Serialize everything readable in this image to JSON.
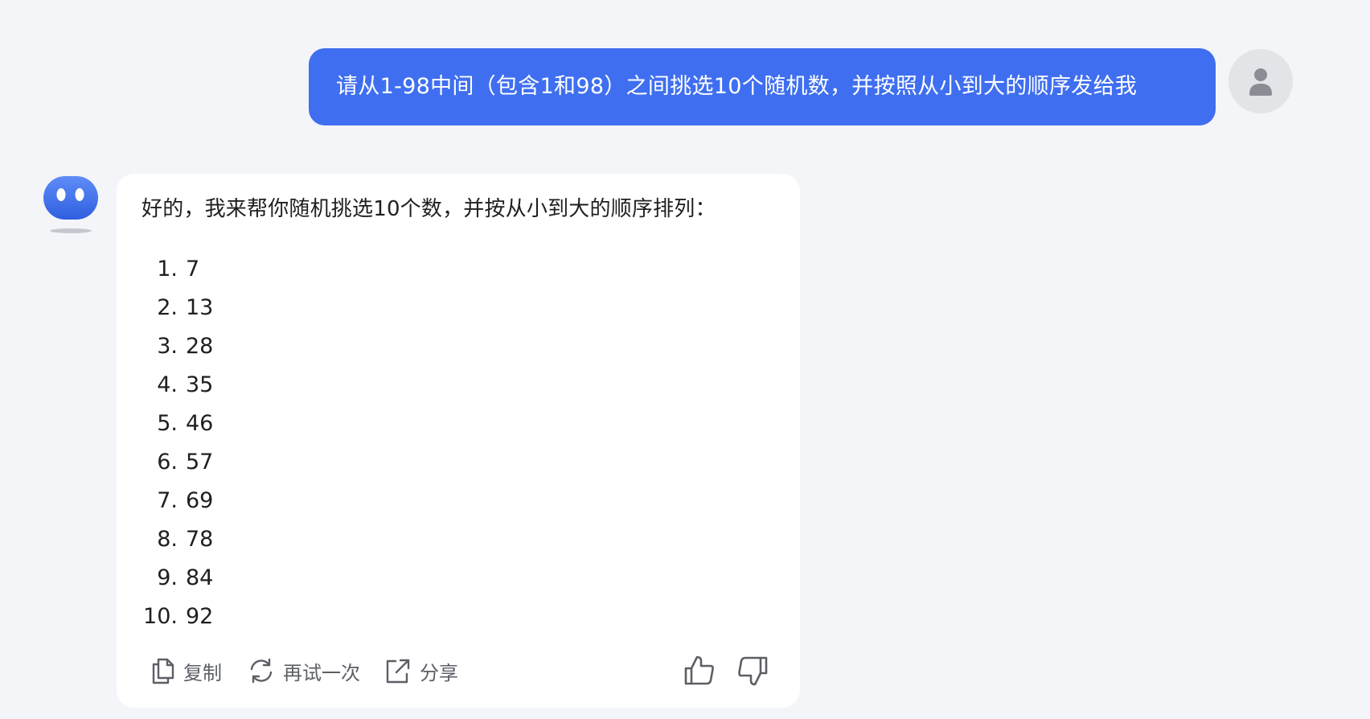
{
  "user_message": {
    "text": "请从1-98中间（包含1和98）之间挑选10个随机数，并按照从小到大的顺序发给我"
  },
  "assistant_message": {
    "intro": "好的，我来帮你随机挑选10个数，并按从小到大的顺序排列：",
    "items": [
      {
        "index": "1.",
        "value": "7"
      },
      {
        "index": "2.",
        "value": "13"
      },
      {
        "index": "3.",
        "value": "28"
      },
      {
        "index": "4.",
        "value": "35"
      },
      {
        "index": "5.",
        "value": "46"
      },
      {
        "index": "6.",
        "value": "57"
      },
      {
        "index": "7.",
        "value": "69"
      },
      {
        "index": "8.",
        "value": "78"
      },
      {
        "index": "9.",
        "value": "84"
      },
      {
        "index": "10.",
        "value": "92"
      }
    ]
  },
  "actions": {
    "copy_label": "复制",
    "retry_label": "再试一次",
    "share_label": "分享"
  },
  "icons": {
    "user_avatar": "person-icon",
    "bot_avatar": "bot-face-icon",
    "copy": "copy-icon",
    "retry": "refresh-icon",
    "share": "share-icon",
    "like": "thumbs-up-icon",
    "dislike": "thumbs-down-icon"
  },
  "colors": {
    "user_bubble": "#3f6ff0",
    "page_background": "#f3f5f9",
    "bot_card": "#ffffff"
  }
}
